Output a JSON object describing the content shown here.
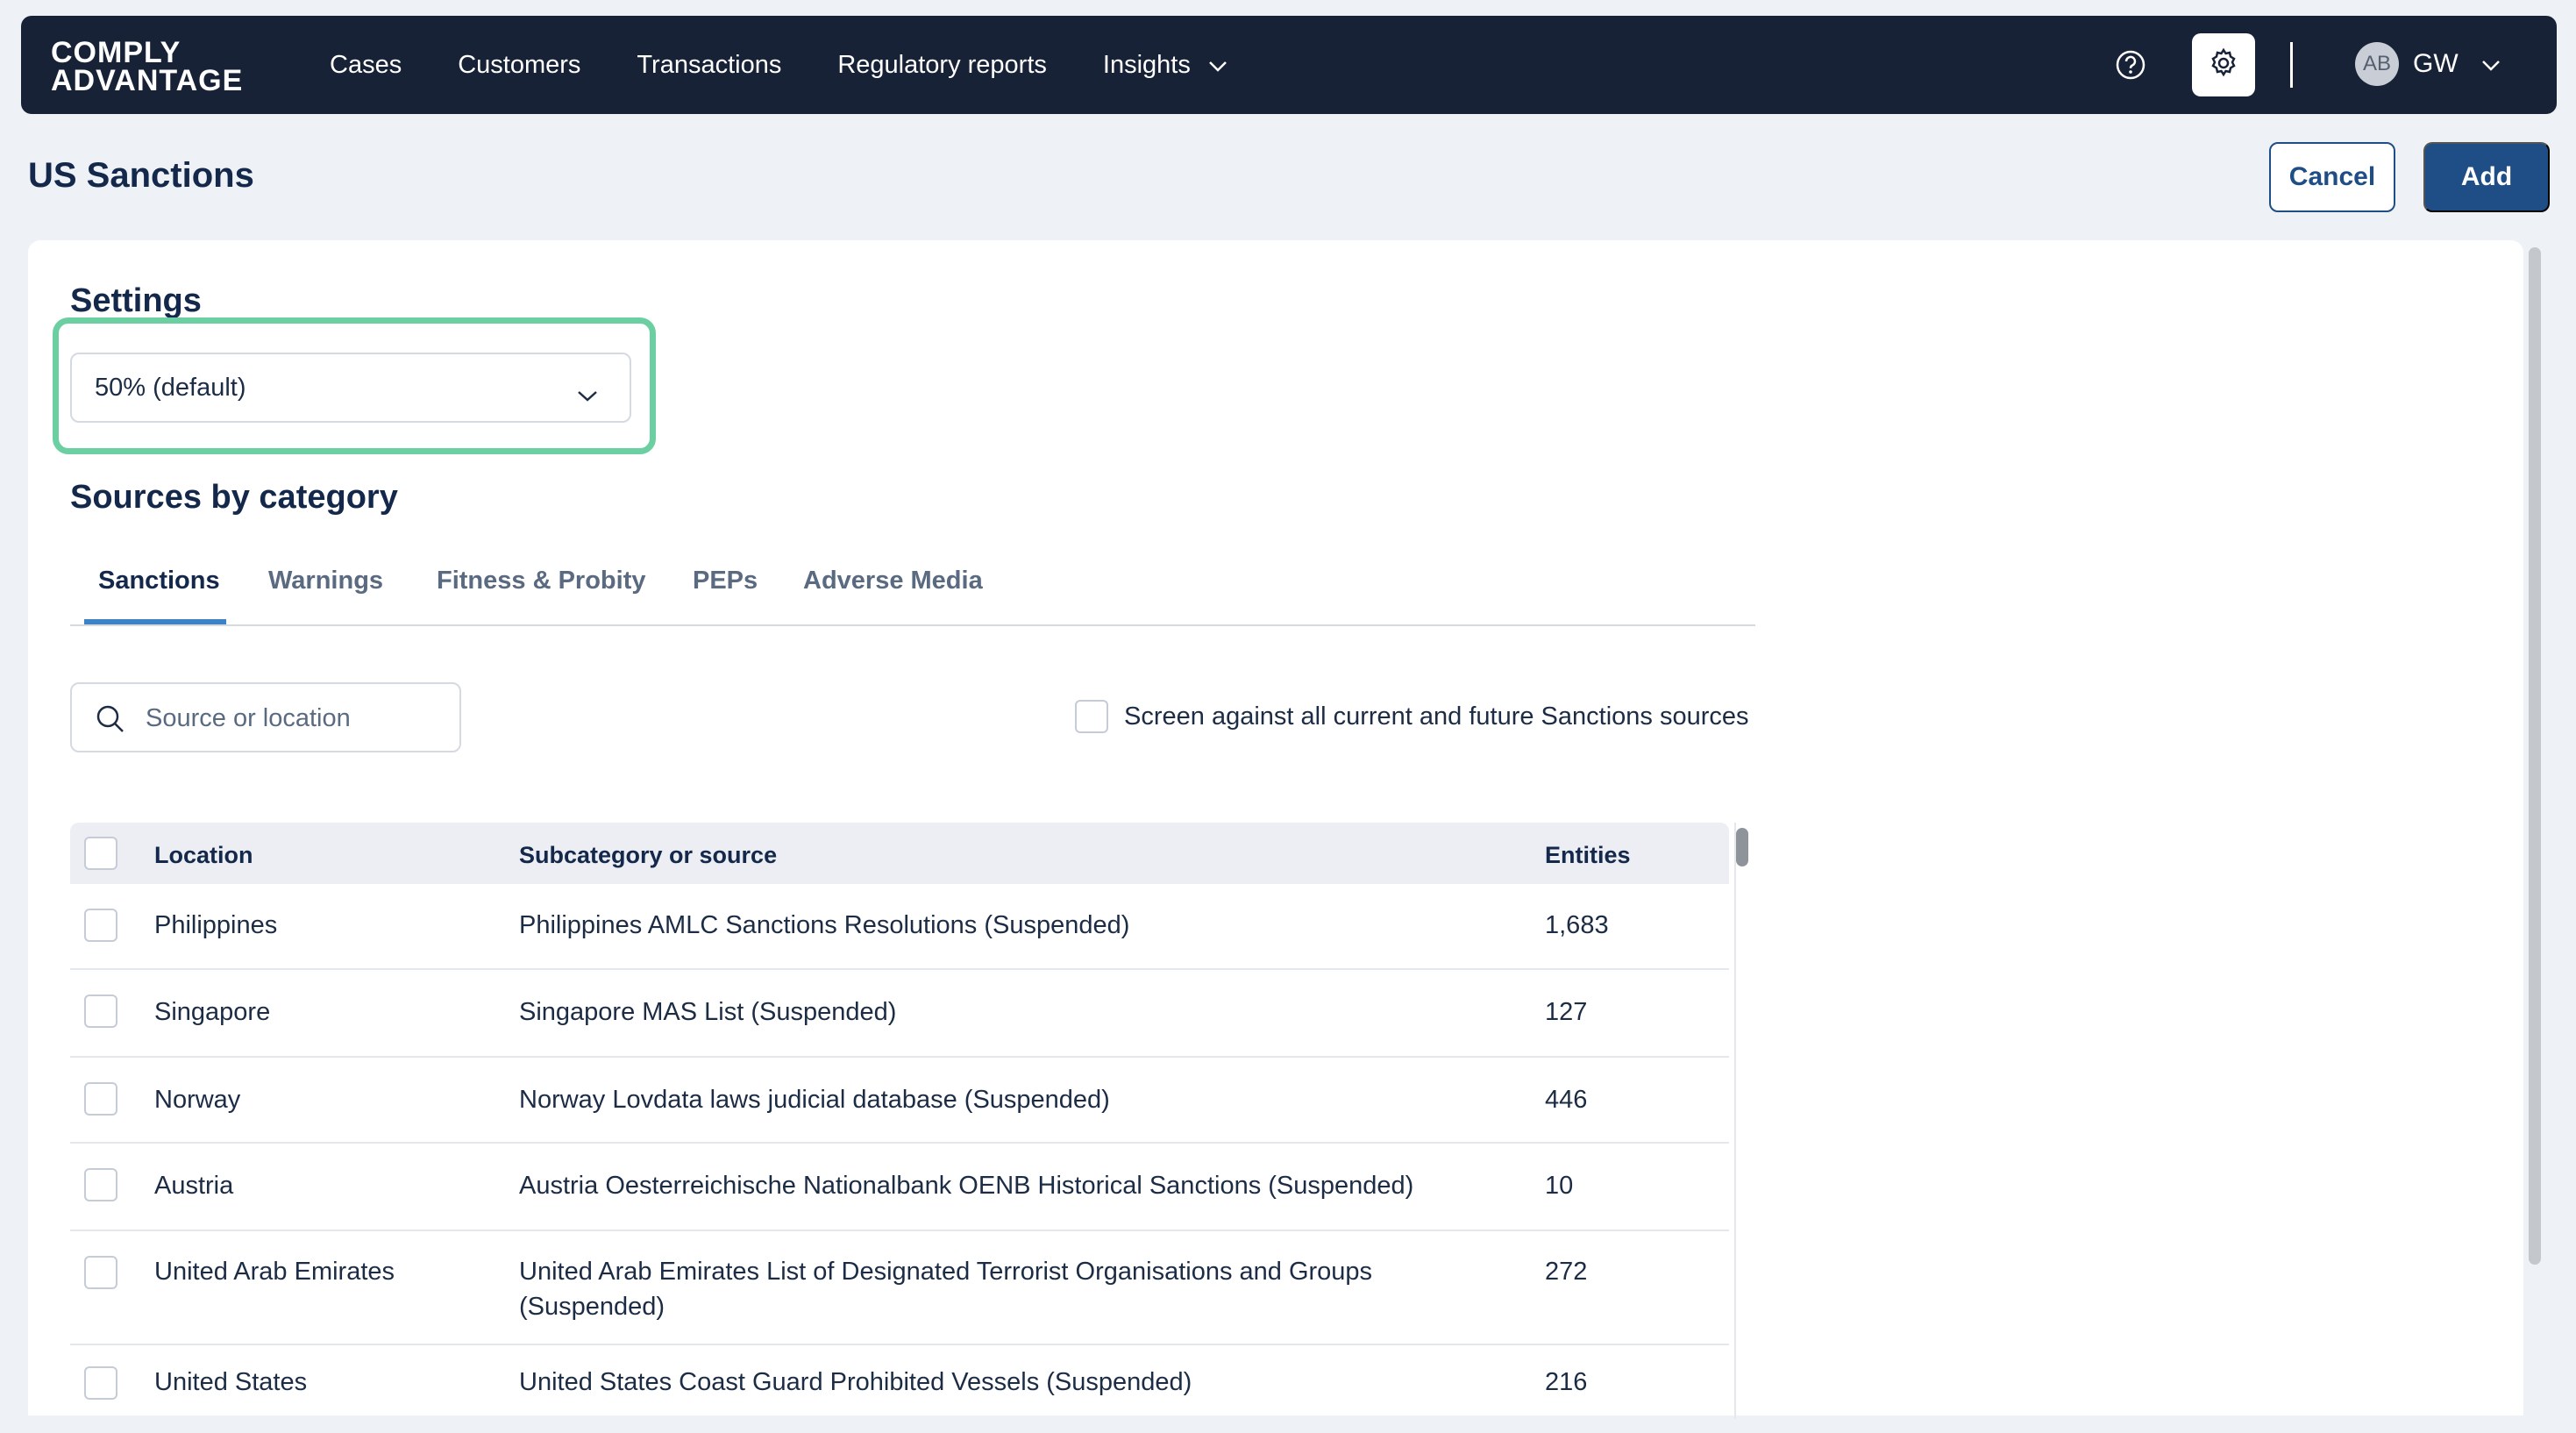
{
  "brand": {
    "line1": "COMPLY",
    "line2": "ADVANTAGE"
  },
  "nav": {
    "items": [
      {
        "label": "Cases"
      },
      {
        "label": "Customers"
      },
      {
        "label": "Transactions"
      },
      {
        "label": "Regulatory reports"
      },
      {
        "label": "Insights"
      }
    ]
  },
  "user": {
    "avatar": "AB",
    "initials": "GW"
  },
  "icons": {
    "help": "help-circle-icon",
    "settings": "gear-icon",
    "search": "search-icon",
    "dropdown": "chevron-down-icon"
  },
  "page": {
    "title": "US Sanctions",
    "cancel_label": "Cancel",
    "add_label": "Add"
  },
  "settings": {
    "heading": "Settings",
    "selected": "50% (default)"
  },
  "sources": {
    "heading": "Sources by category",
    "tabs": [
      {
        "label": "Sanctions",
        "active": true
      },
      {
        "label": "Warnings"
      },
      {
        "label": "Fitness & Probity"
      },
      {
        "label": "PEPs"
      },
      {
        "label": "Adverse Media"
      }
    ],
    "search_placeholder": "Source or location",
    "screen_all_label": "Screen against all current and future Sanctions sources",
    "columns": {
      "location": "Location",
      "source": "Subcategory or source",
      "entities": "Entities"
    },
    "rows": [
      {
        "location": "Philippines",
        "source": "Philippines AMLC Sanctions Resolutions (Suspended)",
        "entities": "1,683"
      },
      {
        "location": "Singapore",
        "source": "Singapore MAS List (Suspended)",
        "entities": "127"
      },
      {
        "location": "Norway",
        "source": "Norway Lovdata laws judicial database (Suspended)",
        "entities": "446"
      },
      {
        "location": "Austria",
        "source": "Austria Oesterreichische Nationalbank OENB Historical Sanctions (Suspended)",
        "entities": "10"
      },
      {
        "location": "United Arab Emirates",
        "source": "United Arab Emirates List of Designated Terrorist Organisations and Groups",
        "source_line2": "(Suspended)",
        "entities": "272"
      },
      {
        "location": "United States",
        "source": "United States Coast Guard Prohibited Vessels (Suspended)",
        "entities": "216"
      }
    ]
  },
  "colors": {
    "topbar": "#172236",
    "primary": "#1f4e86",
    "highlight": "#6ccfa1",
    "tab_underline": "#3d82c4"
  }
}
